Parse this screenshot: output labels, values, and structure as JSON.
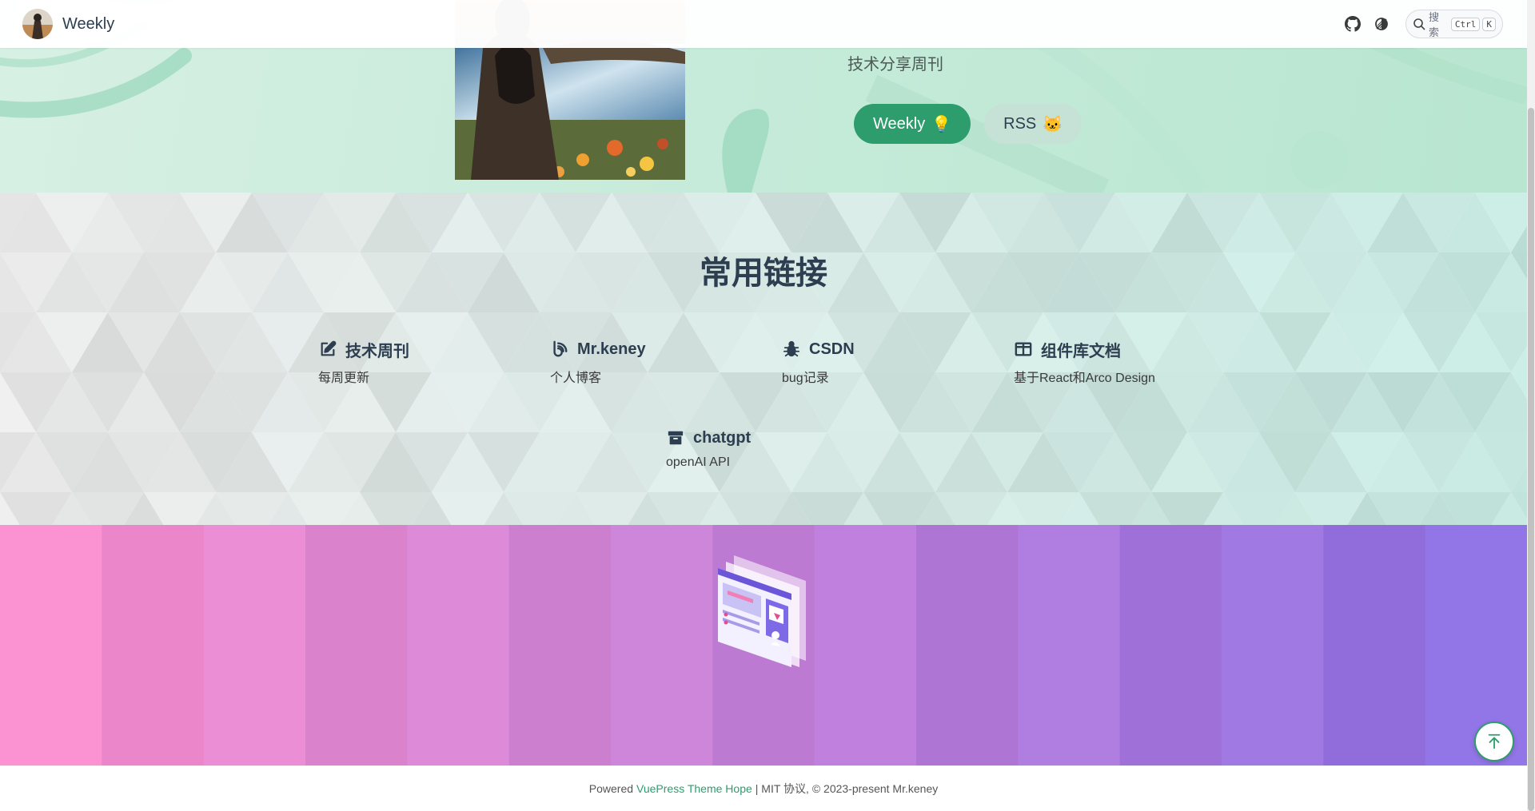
{
  "navbar": {
    "title": "Weekly",
    "avatar_icon": "avatar-icon",
    "github_icon": "github-icon",
    "theme_icon": "theme-toggle-icon",
    "search": {
      "placeholder": "搜索",
      "keys": [
        "Ctrl",
        "K"
      ]
    }
  },
  "hero": {
    "subtitle": "技术分享周刊",
    "actions": [
      {
        "label": "Weekly",
        "emoji": "💡"
      },
      {
        "label": "RSS",
        "emoji": "🐱"
      }
    ]
  },
  "features": {
    "title": "常用链接",
    "items": [
      {
        "icon": "edit-icon",
        "title": "技术周刊",
        "desc": "每周更新"
      },
      {
        "icon": "blog-icon",
        "title": "Mr.keney",
        "desc": "个人博客"
      },
      {
        "icon": "bug-icon",
        "title": "CSDN",
        "desc": "bug记录"
      },
      {
        "icon": "book-open-icon",
        "title": "组件库文档",
        "desc": "基于React和Arco Design"
      },
      {
        "icon": "archive-icon",
        "title": "chatgpt",
        "desc": "openAI API"
      }
    ]
  },
  "footer": {
    "prefix": "Powered",
    "link": "VuePress Theme Hope",
    "suffix": "| MIT 协议, © 2023-present Mr.keney"
  },
  "colors": {
    "accent": "#2d9d6d",
    "hero_bg": "#c7ebda",
    "highlight_from": "#f58ccc",
    "highlight_to": "#8c6fe0"
  }
}
